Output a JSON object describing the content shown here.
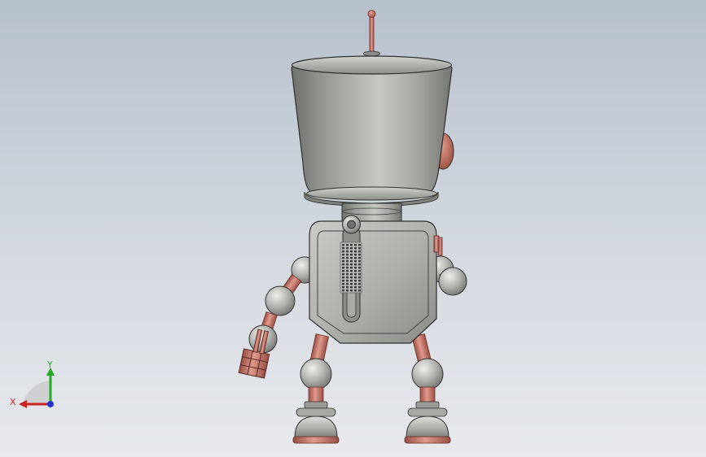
{
  "viewport": {
    "background_top": "#b6c0cc",
    "background_bottom": "#e7e9ed"
  },
  "model": {
    "body_color": "#a7a8a4",
    "joint_color": "#c8766a"
  },
  "triad": {
    "x_label": "X",
    "y_label": "Y",
    "x_color": "#cc2222",
    "y_color": "#22aa22",
    "z_color": "#2233cc"
  }
}
